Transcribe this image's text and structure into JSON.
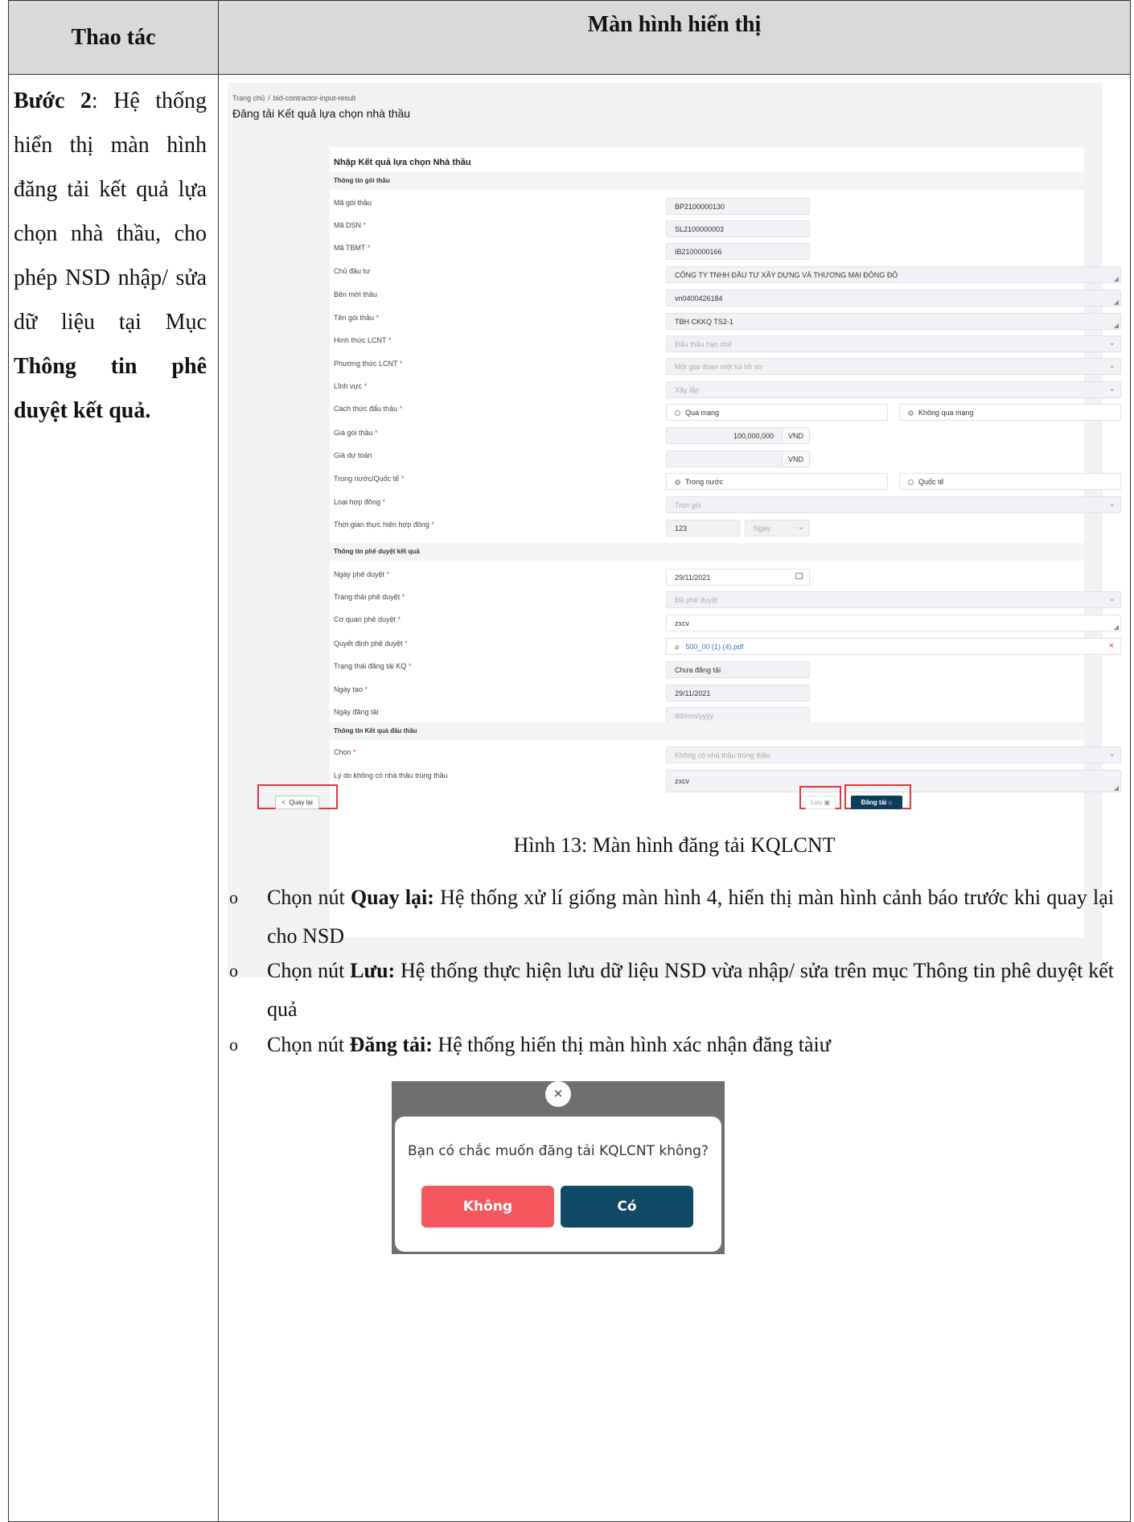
{
  "table": {
    "col_action": "Thao tác",
    "col_screen": "Màn hình hiển thị"
  },
  "step": {
    "label": "Bước 2",
    "text_1": ": Hệ thống hiển thị màn hình đăng tải kết quả lựa chọn nhà thầu, cho phép NSD nhập/ sửa dữ liệu tại Mục ",
    "text_bold": "Thông tin phê duyệt kết quả."
  },
  "screen": {
    "breadcrumb_home": "Trang chủ",
    "breadcrumb_sep": "/",
    "breadcrumb_current": "bid-contractor-input-result",
    "title": "Đăng tải Kết quả lựa chọn nhà thầu",
    "card_title": "Nhập Kết quả lựa chọn Nhà thầu",
    "sections": {
      "package": "Thông tin gói thầu",
      "approval": "Thông tin phê duyệt kết quả",
      "result": "Thông tin Kết quả đấu thầu"
    },
    "fields": {
      "ma_goi_thau": {
        "label": "Mã gói thầu",
        "value": "BP2100000130"
      },
      "ma_dsn": {
        "label": "Mã DSN",
        "value": "SL2100000003"
      },
      "ma_tbmt": {
        "label": "Mã TBMT",
        "value": "IB2100000166"
      },
      "chu_dau_tu": {
        "label": "Chủ đầu tư",
        "value": "CÔNG TY TNHH ĐẦU TƯ XÂY DỰNG VÀ THƯƠNG MẠI ĐÔNG ĐÔ"
      },
      "ben_moi_thau": {
        "label": "Bên mời thầu",
        "value": "vn0400426184"
      },
      "ten_goi_thau": {
        "label": "Tên gói thầu",
        "value": "TBH CKKQ TS2-1"
      },
      "hinh_thuc": {
        "label": "Hình thức LCNT",
        "value": "Đấu thầu hạn chế"
      },
      "phuong_thuc": {
        "label": "Phương thức LCNT",
        "value": "Một giai đoạn một túi hồ sơ"
      },
      "linh_vuc": {
        "label": "Lĩnh vực",
        "value": "Xây lắp"
      },
      "cach_thuc": {
        "label": "Cách thức đấu thầu",
        "option_1": "Qua mạng",
        "option_2": "Không qua mạng"
      },
      "gia_goi_thau": {
        "label": "Giá gói thầu",
        "value": "100,000,000",
        "unit": "VND"
      },
      "gia_du_toan": {
        "label": "Giá dự toán",
        "value": "",
        "unit": "VND"
      },
      "trong_nuoc": {
        "label": "Trong nước/Quốc tế",
        "option_1": "Trong nước",
        "option_2": "Quốc tế"
      },
      "loai_hop_dong": {
        "label": "Loại hợp đồng",
        "value": "Trọn gói"
      },
      "thoi_gian": {
        "label": "Thời gian thực hiện hợp đồng",
        "value": "123",
        "unit": "Ngày"
      },
      "ngay_phe_duyet": {
        "label": "Ngày phê duyệt",
        "value": "29/11/2021"
      },
      "trang_thai_pd": {
        "label": "Trạng thái phê duyệt",
        "value": "Đã phê duyệt"
      },
      "co_quan_pd": {
        "label": "Cơ quan phê duyệt",
        "value": "zxcv"
      },
      "quyet_dinh": {
        "label": "Quyết định phê duyệt",
        "value": "500_00 (1) (4).pdf"
      },
      "trang_thai_dt": {
        "label": "Trạng thái đăng tải KQ",
        "value": "Chưa đăng tải"
      },
      "ngay_tao": {
        "label": "Ngày tạo",
        "value": "29/11/2021"
      },
      "ngay_dang_tai": {
        "label": "Ngày đăng tải",
        "placeholder": "dd/mm/yyyy"
      },
      "chon": {
        "label": "Chọn",
        "value": "Không có nhà thầu trúng thầu"
      },
      "ly_do": {
        "label": "Lý do không có nhà thầu trúng thầu",
        "value": "zxcv"
      }
    },
    "buttons": {
      "back": "Quay lại",
      "save": "Lưu",
      "publish": "Đăng tải"
    }
  },
  "caption": "Hình 13: Màn hình đăng tải KQLCNT",
  "bullets": [
    {
      "prefix": "Chọn nút ",
      "bold": "Quay lại:",
      "text": " Hệ thống xử lí giống màn hình 4, hiển thị màn hình cảnh báo trước khi quay lại cho NSD"
    },
    {
      "prefix": "Chọn nút ",
      "bold": "Lưu:",
      "text": " Hệ thống thực hiện lưu dữ liệu NSD vừa nhập/ sửa trên mục Thông tin phê duyệt kết quả"
    },
    {
      "prefix": "Chọn nút ",
      "bold": "Đăng tải:",
      "text": " Hệ thống hiển thị màn hình xác nhận đăng tàiư"
    }
  ],
  "bullet_marker": "o",
  "dialog": {
    "close": "×",
    "message": "Bạn có chắc muốn đăng tải KQLCNT không?",
    "no": "Không",
    "yes": "Có"
  }
}
